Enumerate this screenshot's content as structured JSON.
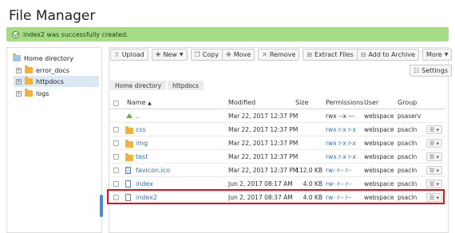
{
  "page": {
    "title": "File Manager",
    "notice": "index2 was successfully created."
  },
  "sidebar": {
    "root": "Home directory",
    "items": [
      {
        "label": "error_docs",
        "expander": "+"
      },
      {
        "label": "httpdocs",
        "expander": "+"
      },
      {
        "label": "logs",
        "expander": "+"
      }
    ]
  },
  "toolbar": {
    "upload": "Upload",
    "new": "New",
    "copy": "Copy",
    "move": "Move",
    "remove": "Remove",
    "extract": "Extract Files",
    "archive": "Add to Archive",
    "more": "More",
    "settings": "Settings"
  },
  "breadcrumb": [
    "Home directory",
    "httpdocs"
  ],
  "table": {
    "headers": {
      "name": "Name",
      "modified": "Modified",
      "size": "Size",
      "permissions": "Permissions",
      "user": "User",
      "group": "Group"
    },
    "sort_arrow": "▲",
    "rows": [
      {
        "icon": "up",
        "name": "..",
        "modified": "Mar 22, 2017 12:37 PM",
        "size": "",
        "permissions": "rwx --x ---",
        "perm_link": false,
        "user": "webspace",
        "group": "psaserv",
        "menu": false
      },
      {
        "icon": "folder",
        "name": "css",
        "modified": "Mar 22, 2017 12:37 PM",
        "size": "",
        "permissions": "rwx r-x r-x",
        "perm_link": true,
        "user": "webspace",
        "group": "psacln",
        "menu": true
      },
      {
        "icon": "folder",
        "name": "img",
        "modified": "Mar 22, 2017 12:37 PM",
        "size": "",
        "permissions": "rwx r-x r-x",
        "perm_link": true,
        "user": "webspace",
        "group": "psacln",
        "menu": true
      },
      {
        "icon": "folder",
        "name": "test",
        "modified": "Mar 22, 2017 12:37 PM",
        "size": "",
        "permissions": "rwx r-x r-x",
        "perm_link": true,
        "user": "webspace",
        "group": "psacln",
        "menu": true
      },
      {
        "icon": "ico",
        "name": "favicon.ico",
        "modified": "Mar 22, 2017 12:37 PM",
        "size": "112.0 KB",
        "permissions": "rw- r-- r--",
        "perm_link": true,
        "user": "webspace",
        "group": "psacln",
        "menu": true
      },
      {
        "icon": "file",
        "name": "index",
        "modified": "Jun 2, 2017 08:17 AM",
        "size": "4.0 KB",
        "permissions": "rw- r-- r--",
        "perm_link": true,
        "user": "webspace",
        "group": "psacln",
        "menu": true
      },
      {
        "icon": "file",
        "name": "index2",
        "modified": "Jun 2, 2017 08:37 AM",
        "size": "4.0 KB",
        "permissions": "rw- r-- r--",
        "perm_link": true,
        "user": "webspace",
        "group": "psacln",
        "menu": true
      }
    ]
  },
  "colors": {
    "notice_bg": "#a6dc86",
    "link": "#2d73c0",
    "highlight": "#e0141d",
    "folder": "#f0b13f"
  }
}
